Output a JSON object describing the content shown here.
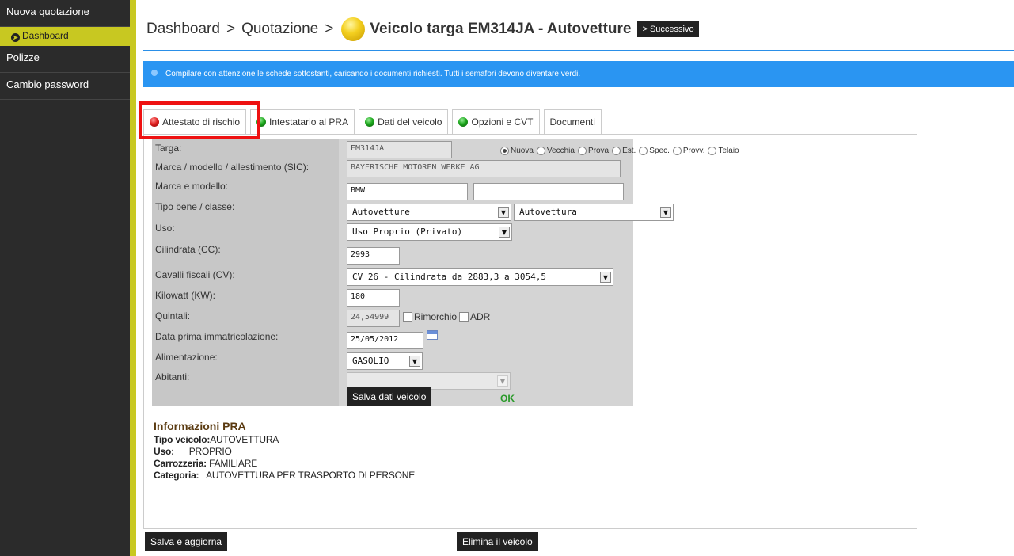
{
  "sidebar": {
    "items": [
      {
        "label": "Nuova quotazione"
      },
      {
        "label": "Dashboard"
      },
      {
        "label": "Polizze"
      },
      {
        "label": "Cambio password"
      }
    ]
  },
  "header": {
    "crumb1": "Dashboard",
    "crumb2": "Quotazione",
    "separator": ">",
    "title": "Veicolo targa EM314JA - Autovetture",
    "next_label": "> Successivo"
  },
  "info": {
    "message": "Compilare con attenzione le schede sottostanti, caricando i documenti richiesti. Tutti i semafori devono diventare verdi."
  },
  "tabs": [
    {
      "label": "Attestato di rischio",
      "status": "red"
    },
    {
      "label": "Intestatario al PRA",
      "status": "green"
    },
    {
      "label": "Dati del veicolo",
      "status": "green"
    },
    {
      "label": "Opzioni e CVT",
      "status": "green"
    },
    {
      "label": "Documenti",
      "status": "none"
    }
  ],
  "form": {
    "targa": {
      "label": "Targa:",
      "value": "EM314JA"
    },
    "plate_types": [
      {
        "label": "Nuova",
        "checked": true
      },
      {
        "label": "Vecchia",
        "checked": false
      },
      {
        "label": "Prova",
        "checked": false
      },
      {
        "label": "Est.",
        "checked": false
      },
      {
        "label": "Spec.",
        "checked": false
      },
      {
        "label": "Provv.",
        "checked": false
      },
      {
        "label": "Telaio",
        "checked": false
      }
    ],
    "sic": {
      "label": "Marca / modello / allestimento (SIC):",
      "value": "BAYERISCHE MOTOREN WERKE AG"
    },
    "marca": {
      "label": "Marca e modello:",
      "value1": "BMW",
      "value2": ""
    },
    "tipo": {
      "label": "Tipo bene / classe:",
      "value1": "Autovetture",
      "value2": "Autovettura"
    },
    "uso": {
      "label": "Uso:",
      "value": "Uso Proprio (Privato)"
    },
    "cilindrata": {
      "label": "Cilindrata (CC):",
      "value": "2993"
    },
    "cavalli": {
      "label": "Cavalli fiscali (CV):",
      "value": "CV 26 - Cilindrata da 2883,3 a 3054,5"
    },
    "kilowatt": {
      "label": "Kilowatt (KW):",
      "value": "180"
    },
    "quintali": {
      "label": "Quintali:",
      "value": "24,54999",
      "rimorchio": "Rimorchio",
      "adr": "ADR"
    },
    "data": {
      "label": "Data prima immatricolazione:",
      "value": "25/05/2012"
    },
    "alimentazione": {
      "label": "Alimentazione:",
      "value": "GASOLIO"
    },
    "abitanti": {
      "label": "Abitanti:",
      "value": ""
    },
    "save_label": "Salva dati veicolo",
    "status": "OK"
  },
  "pra": {
    "title": "Informazioni PRA",
    "tipo_label": "Tipo veicolo:",
    "tipo_value": "AUTOVETTURA",
    "uso_label": "Uso:",
    "uso_value": "PROPRIO",
    "carrozzeria_label": "Carrozzeria:",
    "carrozzeria_value": "FAMILIARE",
    "categoria_label": "Categoria:",
    "categoria_value": "AUTOVETTURA PER TRASPORTO DI PERSONE"
  },
  "footer": {
    "save_update_label": "Salva e aggiorna",
    "delete_label": "Elimina il veicolo"
  },
  "colors": {
    "sidebar_bg": "#2b2b2b",
    "accent": "#c8c821",
    "info_bg": "#2a95f2",
    "highlight": "#ee1111"
  }
}
